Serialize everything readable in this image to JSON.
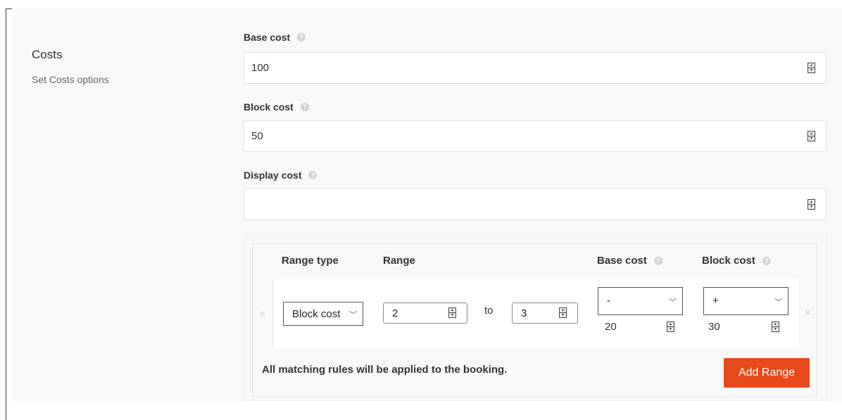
{
  "section": {
    "title": "Costs",
    "description": "Set Costs options"
  },
  "fields": {
    "base_cost": {
      "label": "Base cost",
      "value": "100"
    },
    "block_cost": {
      "label": "Block cost",
      "value": "50"
    },
    "display_cost": {
      "label": "Display cost",
      "value": ""
    }
  },
  "icons": {
    "help": "help-icon",
    "spinner": "spinner-arrows-icon",
    "chevron": "chevron-down-icon",
    "drag": "drag-handle-icon",
    "remove": "close-icon"
  },
  "ranges": {
    "columns": {
      "range_type": "Range type",
      "range": "Range",
      "base_cost": "Base cost",
      "block_cost": "Block cost"
    },
    "rule": {
      "range_type": "Block cost",
      "from": "2",
      "to_label": "to",
      "to": "3",
      "base_modifier": "-",
      "base_value": "20",
      "block_modifier": "+",
      "block_value": "30"
    },
    "note": "All matching rules will be applied to the booking.",
    "add_button": "Add Range"
  },
  "colors": {
    "accent": "#e8491b",
    "panel_bg": "#f8f8f8"
  }
}
